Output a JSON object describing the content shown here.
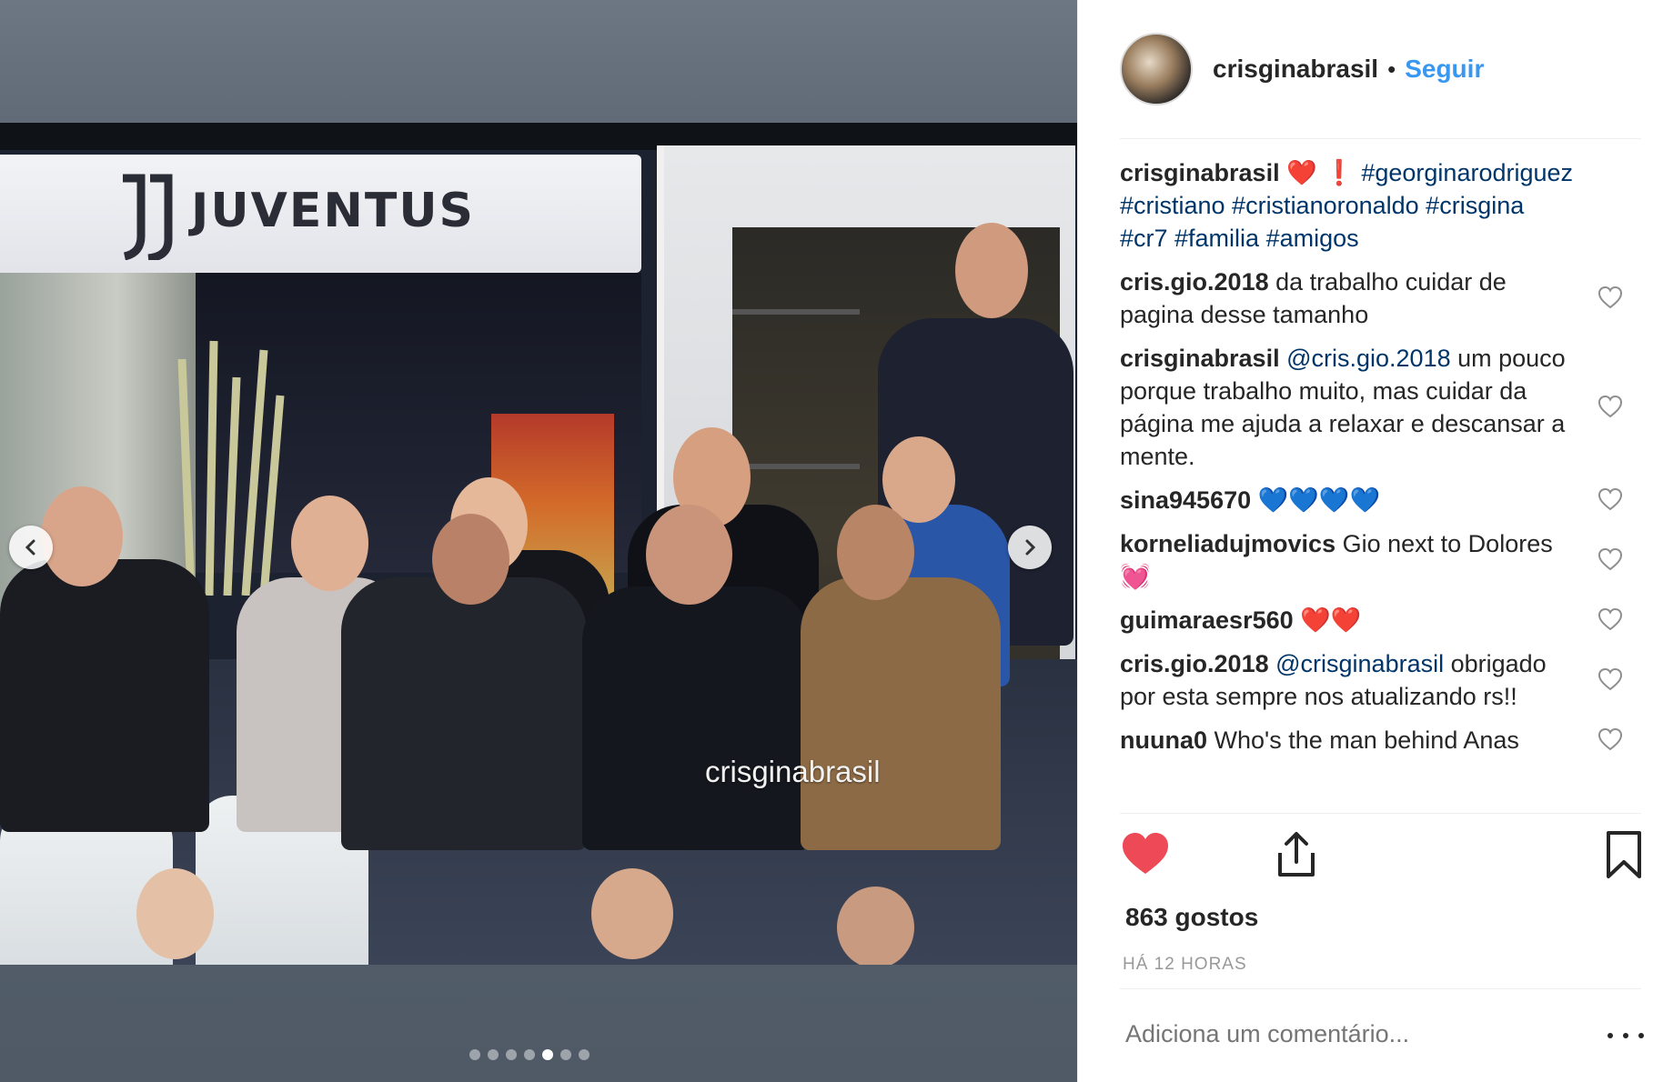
{
  "post": {
    "watermark": "crisginabrasil",
    "banner_text": "JUVENTUS",
    "carousel": {
      "total": 7,
      "active_index": 4
    }
  },
  "header": {
    "username": "crisginabrasil",
    "separator": "•",
    "follow_label": "Seguir"
  },
  "caption": {
    "username": "crisginabrasil",
    "emoji": "❤️ ❗ ",
    "hashtags": "#georginarodriguez #cristiano #cristianoronaldo #crisgina #cr7 #familia #amigos"
  },
  "comments": [
    {
      "user": "cris.gio.2018",
      "mention": "",
      "text": "da trabalho cuidar de pagina desse tamanho"
    },
    {
      "user": "crisginabrasil",
      "mention": "@cris.gio.2018",
      "text": "um pouco porque trabalho muito, mas cuidar da página me ajuda a relaxar e descansar a mente."
    },
    {
      "user": "sina945670",
      "mention": "",
      "text": "💙💙💙💙"
    },
    {
      "user": "korneliadujmovics",
      "mention": "",
      "text": "Gio next to Dolores💓"
    },
    {
      "user": "guimaraesr560",
      "mention": "",
      "text": "❤️❤️"
    },
    {
      "user": "cris.gio.2018",
      "mention": "@crisginabrasil",
      "text": "obrigado por esta sempre nos atualizando rs!!"
    },
    {
      "user": "nuuna0",
      "mention": "",
      "text": "Who's the man behind Anas"
    }
  ],
  "likes": "863 gostos",
  "timestamp": "HÁ 12 HORAS",
  "add_comment": {
    "placeholder": "Adiciona um comentário..."
  },
  "colors": {
    "link": "#3897f0",
    "like_red": "#ed4956",
    "tag": "#003569",
    "muted": "#999999"
  },
  "icons": {
    "like": "heart-filled-icon",
    "comment": "speech-bubble-icon",
    "share": "share-upload-icon",
    "save": "bookmark-icon",
    "comment_like": "heart-outline-icon",
    "more": "ellipsis-icon",
    "prev": "chevron-left-icon",
    "next": "chevron-right-icon"
  }
}
